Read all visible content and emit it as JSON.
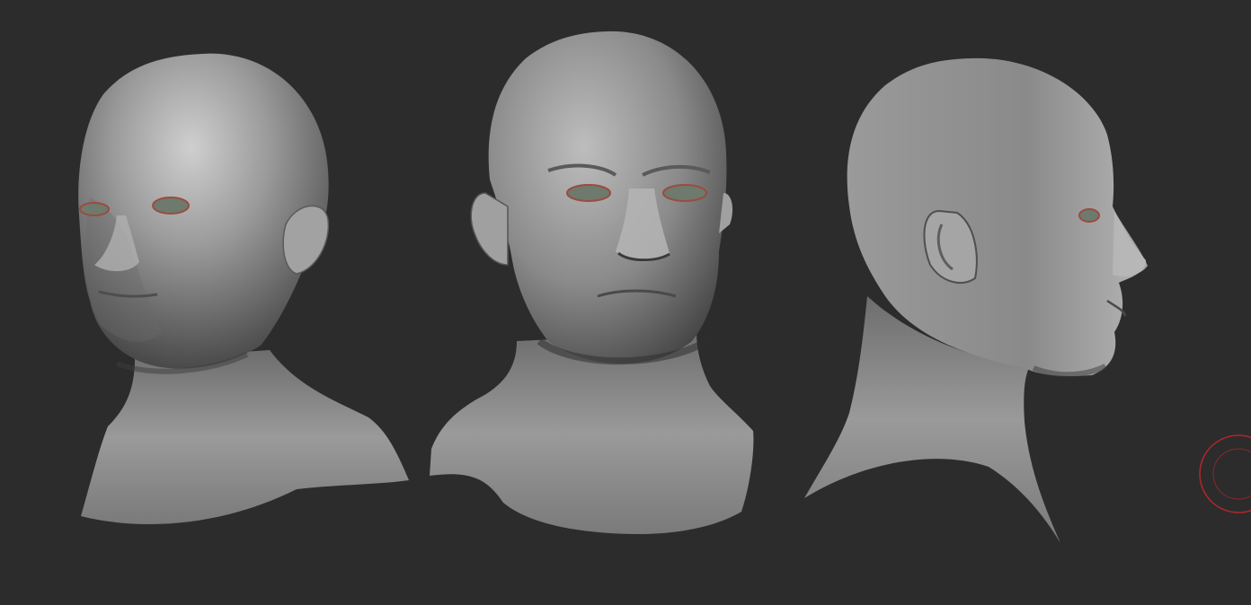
{
  "viewport": {
    "background": "#2c2c2c",
    "material_color": "#8f8f8f",
    "eye_color": "#6e7a6e",
    "eyelid_color": "#9c4b3f"
  },
  "views": [
    {
      "view": "three-quarter",
      "facing": "left"
    },
    {
      "view": "front",
      "facing": "front"
    },
    {
      "view": "profile",
      "facing": "right"
    }
  ],
  "brush_cursor": {
    "color": "#b3262c",
    "icon": "brush-circle-icon"
  }
}
